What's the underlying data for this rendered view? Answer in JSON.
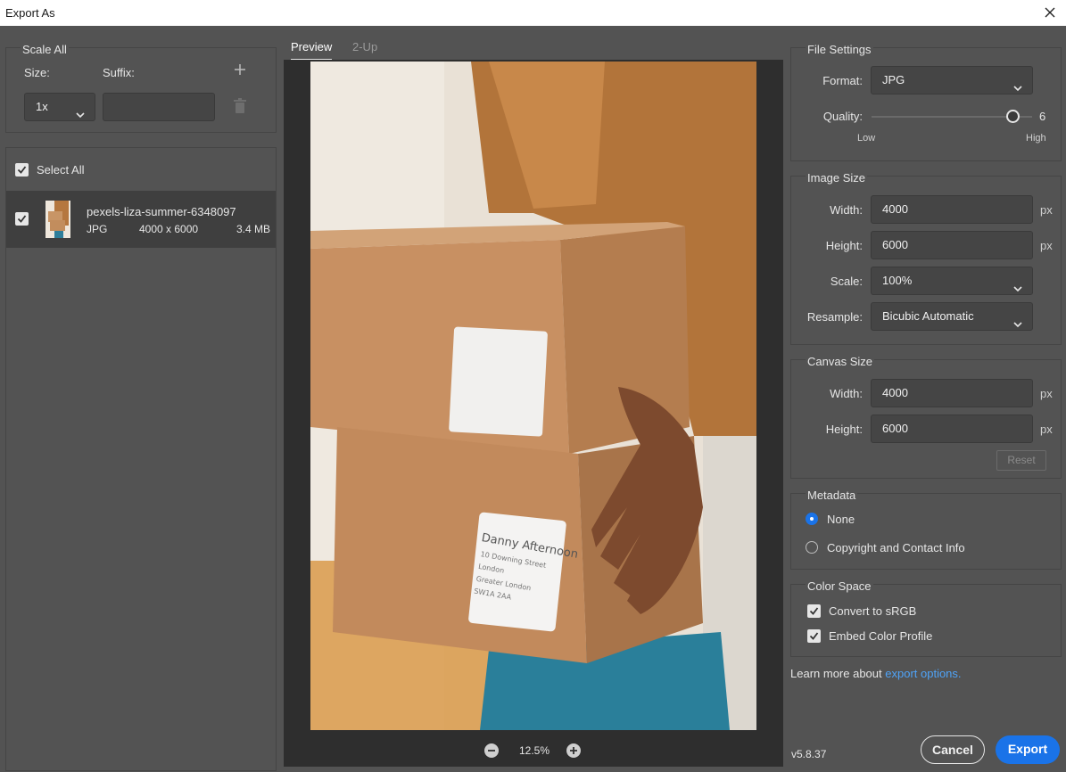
{
  "window": {
    "title": "Export As"
  },
  "scale_all": {
    "title": "Scale All",
    "size_label": "Size:",
    "suffix_label": "Suffix:",
    "size_value": "1x",
    "suffix_value": ""
  },
  "assets": {
    "select_all_label": "Select All",
    "items": [
      {
        "name": "pexels-liza-summer-6348097",
        "format": "JPG",
        "dimensions": "4000 x 6000",
        "size": "3.4 MB"
      }
    ]
  },
  "preview": {
    "tabs": [
      "Preview",
      "2-Up"
    ],
    "zoom": "12.5%",
    "label_text": [
      "Danny Afternoon",
      "10 Downing Street",
      "London",
      "Greater London",
      "SW1A 2AA"
    ]
  },
  "file_settings": {
    "title": "File Settings",
    "format_label": "Format:",
    "format_value": "JPG",
    "quality_label": "Quality:",
    "quality_value": "6",
    "quality_fraction": 0.88,
    "low_label": "Low",
    "high_label": "High"
  },
  "image_size": {
    "title": "Image Size",
    "width_label": "Width:",
    "width_value": "4000",
    "height_label": "Height:",
    "height_value": "6000",
    "scale_label": "Scale:",
    "scale_value": "100%",
    "resample_label": "Resample:",
    "resample_value": "Bicubic Automatic",
    "unit": "px"
  },
  "canvas_size": {
    "title": "Canvas Size",
    "width_label": "Width:",
    "width_value": "4000",
    "height_label": "Height:",
    "height_value": "6000",
    "unit": "px",
    "reset_label": "Reset"
  },
  "metadata": {
    "title": "Metadata",
    "options": [
      "None",
      "Copyright and Contact Info"
    ],
    "selected": "None"
  },
  "color_space": {
    "title": "Color Space",
    "convert_label": "Convert to sRGB",
    "embed_label": "Embed Color Profile"
  },
  "footer": {
    "learn_more": "Learn more about",
    "link_text": "export options.",
    "version": "v5.8.37",
    "cancel_label": "Cancel",
    "export_label": "Export"
  },
  "colors": {
    "accent": "#1a73e8",
    "link": "#4fa3f7",
    "panel_bg": "#535353",
    "field_bg": "#454545"
  }
}
